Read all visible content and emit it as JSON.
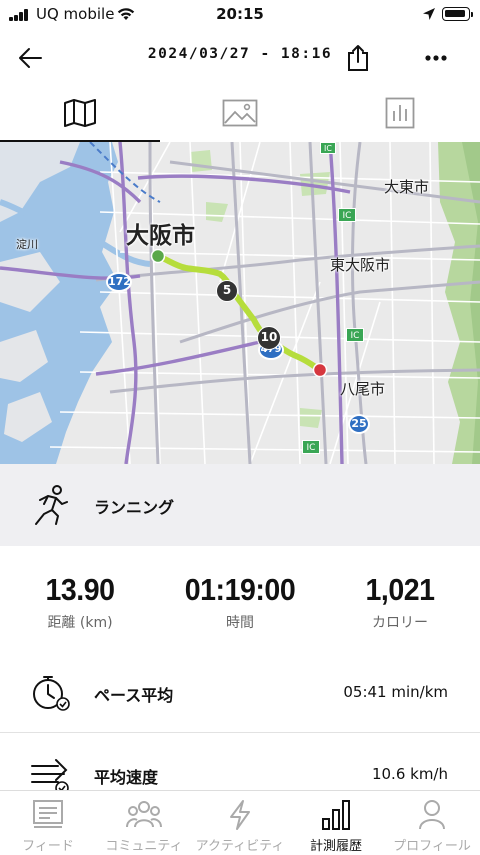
{
  "status_bar": {
    "carrier": "UQ mobile",
    "time": "20:15"
  },
  "header": {
    "title": "2024/03/27 - 18:16"
  },
  "view_tabs": [
    "map-view",
    "photo-view",
    "chart-view"
  ],
  "map": {
    "labels": {
      "osaka": "大阪市",
      "daito": "大東市",
      "higashiosaka": "東大阪市",
      "yao": "八尾市",
      "yodogawa": "淀川",
      "route172": "172",
      "route479": "479",
      "route25": "25",
      "ic1": "IC",
      "ic2": "IC",
      "ic3": "IC",
      "ic4": "IC"
    },
    "markers": {
      "km5": "5",
      "km10": "10"
    },
    "colors": {
      "route": "#b6dd3c",
      "start": "#5aa84a",
      "end": "#d6373f"
    }
  },
  "activity": {
    "type": "ランニング"
  },
  "stats": {
    "distance": {
      "value": "13.90",
      "caption": "距離 (km)"
    },
    "time": {
      "value": "01:19:00",
      "caption": "時間"
    },
    "calories": {
      "value": "1,021",
      "caption": "カロリー"
    }
  },
  "metrics": {
    "pace": {
      "label": "ペース平均",
      "value": "05:41 min/km"
    },
    "speed": {
      "label": "平均速度",
      "value": "10.6 km/h"
    }
  },
  "bottom_nav": {
    "feed": "フィード",
    "community": "コミュニティ",
    "activity": "アクティビティ",
    "history": "計測履歴",
    "profile": "プロフィール"
  }
}
